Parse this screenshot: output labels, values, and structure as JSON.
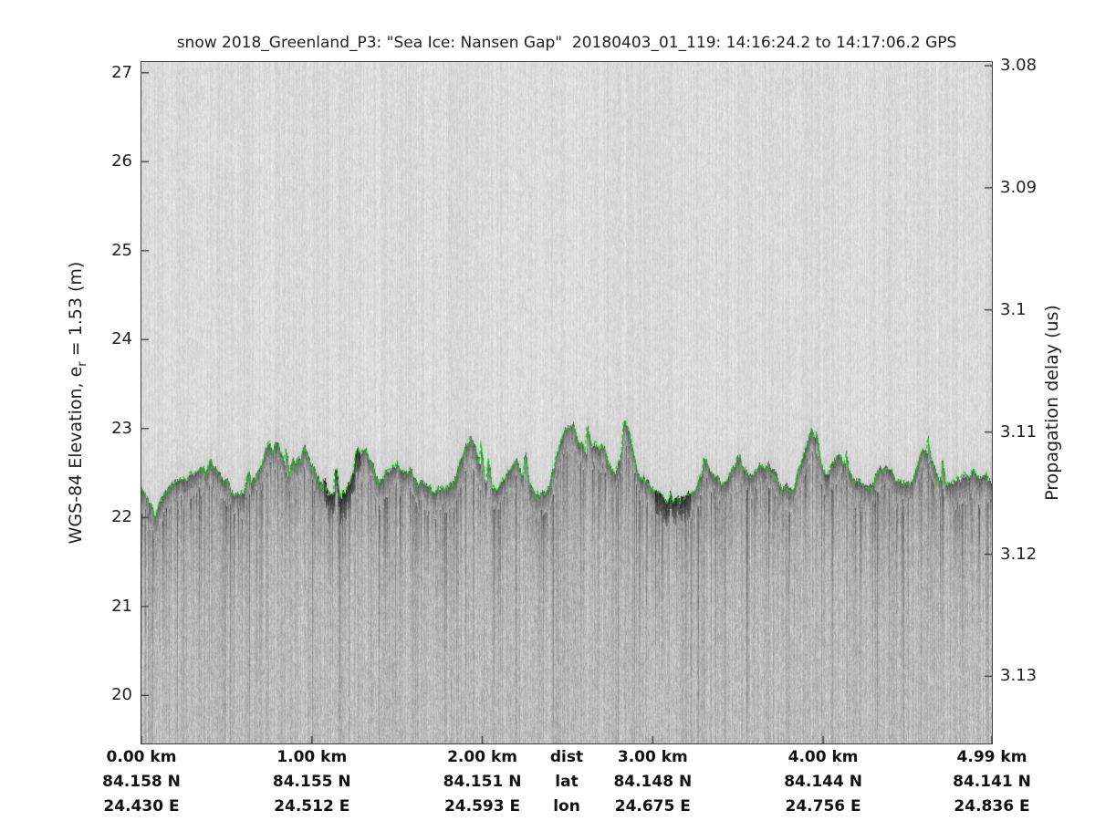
{
  "title": "snow 2018_Greenland_P3: \"Sea Ice: Nansen Gap\"  20180403_01_119: 14:16:24.2 to 14:17:06.2 GPS",
  "left_axis_label": {
    "pre": "WGS-84 Elevation, e",
    "sub": "r",
    "post": " = 1.53 (m)"
  },
  "right_axis_label": "Propagation delay (us)",
  "chart_data": {
    "type": "heatmap",
    "description": "Grayscale snow-radar echogram of sea ice; dark band is the ice/snow surface return near 22.2-23.1 m elevation, tracked by a dashed green surface pick; diffuse vertical fading streaks below the surface band.",
    "title": "snow 2018_Greenland_P3: \"Sea Ice: Nansen Gap\"  20180403_01_119: 14:16:24.2 to 14:17:06.2 GPS",
    "left_ylabel": "WGS-84 Elevation, e_r = 1.53 (m)",
    "right_ylabel": "Propagation delay (us)",
    "xlim_km": [
      0,
      4.99
    ],
    "elevation_ylim_m": [
      19.46,
      27.12
    ],
    "delay_ylim_us": [
      3.0797,
      3.1355
    ],
    "grid": false,
    "elevation_ticks": [
      {
        "v": 27,
        "label": "27"
      },
      {
        "v": 26,
        "label": "26"
      },
      {
        "v": 25,
        "label": "25"
      },
      {
        "v": 24,
        "label": "24"
      },
      {
        "v": 23,
        "label": "23"
      },
      {
        "v": 22,
        "label": "22"
      },
      {
        "v": 21,
        "label": "21"
      },
      {
        "v": 20,
        "label": "20"
      }
    ],
    "delay_ticks": [
      {
        "v": 3.08,
        "label": "3.08"
      },
      {
        "v": 3.09,
        "label": "3.09"
      },
      {
        "v": 3.1,
        "label": "3.1"
      },
      {
        "v": 3.11,
        "label": "3.11"
      },
      {
        "v": 3.12,
        "label": "3.12"
      },
      {
        "v": 3.13,
        "label": "3.13"
      }
    ],
    "x_ticks": [
      {
        "km": 0.0,
        "dist": "0.00 km",
        "lat": "84.158 N",
        "lon": "24.430 E"
      },
      {
        "km": 1.0,
        "dist": "1.00 km",
        "lat": "84.155 N",
        "lon": "24.512 E"
      },
      {
        "km": 2.0,
        "dist": "2.00 km",
        "lat": "84.151 N",
        "lon": "24.593 E"
      },
      {
        "km": 3.0,
        "dist": "3.00 km",
        "lat": "84.148 N",
        "lon": "24.675 E"
      },
      {
        "km": 4.0,
        "dist": "4.00 km",
        "lat": "84.144 N",
        "lon": "24.756 E"
      },
      {
        "km": 4.99,
        "dist": "4.99 km",
        "lat": "84.141 N",
        "lon": "24.836 E"
      }
    ],
    "x_units_labels": {
      "dist": "dist",
      "lat": "lat",
      "lon": "lon"
    },
    "x_units_km": 2.495,
    "surface_profile": {
      "x_km": [
        0.0,
        0.08,
        0.16,
        0.29,
        0.43,
        0.54,
        0.64,
        0.75,
        0.86,
        0.96,
        1.07,
        1.18,
        1.31,
        1.39,
        1.5,
        1.61,
        1.69,
        1.79,
        1.93,
        2.01,
        2.11,
        2.19,
        2.27,
        2.38,
        2.46,
        2.54,
        2.62,
        2.7,
        2.78,
        2.86,
        2.92,
        3.0,
        3.08,
        3.16,
        3.24,
        3.32,
        3.4,
        3.51,
        3.59,
        3.67,
        3.75,
        3.83,
        3.93,
        4.01,
        4.09,
        4.17,
        4.26,
        4.34,
        4.42,
        4.52,
        4.6,
        4.68,
        4.79,
        4.87,
        4.95,
        4.99
      ],
      "elev_m": [
        22.35,
        22.05,
        22.4,
        22.45,
        22.55,
        22.3,
        22.35,
        22.85,
        22.5,
        22.8,
        22.3,
        22.22,
        22.8,
        22.45,
        22.6,
        22.4,
        22.35,
        22.3,
        22.9,
        22.4,
        22.35,
        22.7,
        22.35,
        22.3,
        22.9,
        23.05,
        22.7,
        22.85,
        22.5,
        23.0,
        22.5,
        22.35,
        22.2,
        22.22,
        22.3,
        22.55,
        22.4,
        22.6,
        22.5,
        22.65,
        22.4,
        22.35,
        23.0,
        22.5,
        22.7,
        22.45,
        22.35,
        22.6,
        22.4,
        22.45,
        22.8,
        22.45,
        22.4,
        22.5,
        22.45,
        22.4
      ]
    },
    "dark_patches_km": [
      [
        1.07,
        1.28
      ],
      [
        3.01,
        3.22
      ]
    ],
    "colors": {
      "surface_line": "#00e600",
      "axis": "#333333",
      "text": "#1f1f1f",
      "background": "#ffffff"
    },
    "noise": {
      "seed": 20180403,
      "above_mean": 218,
      "band_dark_min": 92,
      "band_patch_min": 42,
      "below_mean": 188
    }
  }
}
